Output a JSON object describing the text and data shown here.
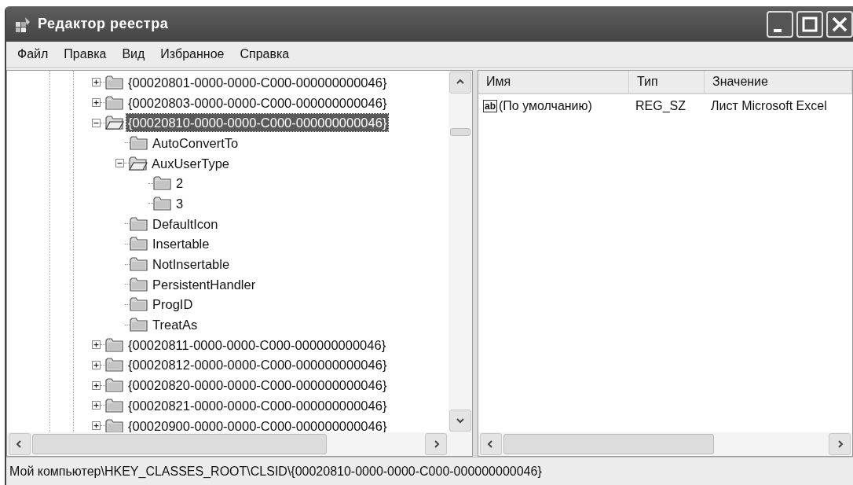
{
  "window": {
    "title": "Редактор реестра"
  },
  "menu": [
    {
      "label": "Файл"
    },
    {
      "label": "Правка"
    },
    {
      "label": "Вид"
    },
    {
      "label": "Избранное"
    },
    {
      "label": "Справка"
    }
  ],
  "tree": {
    "items": [
      {
        "label": "{00020801-0000-0000-C000-000000000046}",
        "expanded": false,
        "selected": false
      },
      {
        "label": "{00020803-0000-0000-C000-000000000046}",
        "expanded": false,
        "selected": false
      },
      {
        "label": "{00020810-0000-0000-C000-000000000046}",
        "expanded": true,
        "selected": true,
        "children": [
          {
            "label": "AutoConvertTo",
            "selected": false
          },
          {
            "label": "AuxUserType",
            "expanded": true,
            "selected": false,
            "children": [
              {
                "label": "2",
                "selected": false
              },
              {
                "label": "3",
                "selected": false
              }
            ]
          },
          {
            "label": "DefaultIcon",
            "selected": false
          },
          {
            "label": "Insertable",
            "selected": false
          },
          {
            "label": "NotInsertable",
            "selected": false
          },
          {
            "label": "PersistentHandler",
            "selected": false
          },
          {
            "label": "ProgID",
            "selected": false
          },
          {
            "label": "TreatAs",
            "selected": false
          }
        ]
      },
      {
        "label": "{00020811-0000-0000-C000-000000000046}",
        "expanded": false,
        "selected": false
      },
      {
        "label": "{00020812-0000-0000-C000-000000000046}",
        "expanded": false,
        "selected": false
      },
      {
        "label": "{00020820-0000-0000-C000-000000000046}",
        "expanded": false,
        "selected": false
      },
      {
        "label": "{00020821-0000-0000-C000-000000000046}",
        "expanded": false,
        "selected": false
      },
      {
        "label": "{00020900-0000-0000-C000-000000000046}",
        "expanded": false,
        "selected": false
      }
    ]
  },
  "values": {
    "columns": [
      "Имя",
      "Тип",
      "Значение"
    ],
    "rows": [
      {
        "icon_label": "ab",
        "name": "(По умолчанию)",
        "type": "REG_SZ",
        "value": "Лист Microsoft Excel",
        "selected": false
      }
    ]
  },
  "status_bar": "Мой компьютер\\HKEY_CLASSES_ROOT\\CLSID\\{00020810-0000-0000-C000-000000000046}"
}
